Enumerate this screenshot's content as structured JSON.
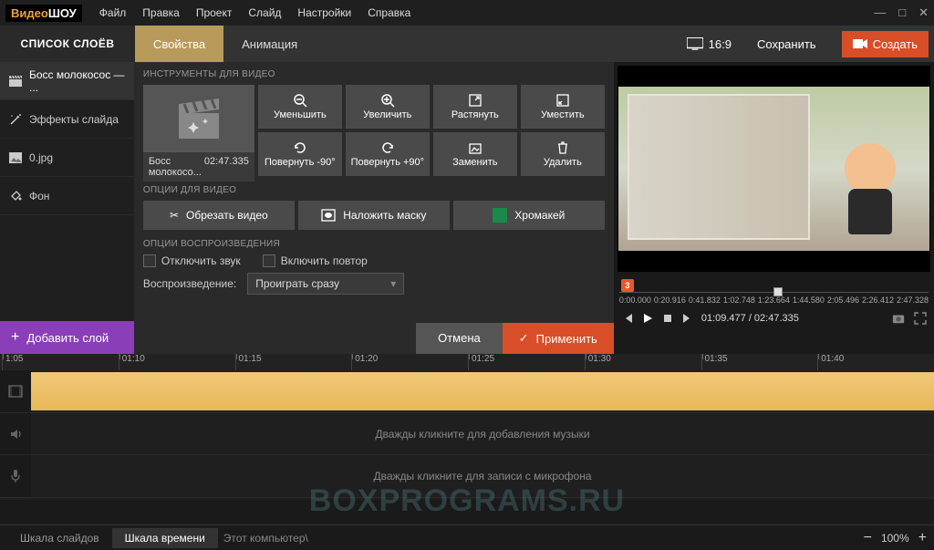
{
  "app": {
    "logo_a": "Видео",
    "logo_b": "ШОУ"
  },
  "menu": [
    "Файл",
    "Правка",
    "Проект",
    "Слайд",
    "Настройки",
    "Справка"
  ],
  "header": {
    "layers_title": "СПИСОК СЛОЁВ",
    "tab_props": "Свойства",
    "tab_anim": "Анимация",
    "aspect": "16:9",
    "save": "Сохранить",
    "create": "Создать"
  },
  "layers": [
    {
      "label": "Босс молокосос — ..."
    },
    {
      "label": "Эффекты слайда"
    },
    {
      "label": "0.jpg"
    },
    {
      "label": "Фон"
    }
  ],
  "add_layer": "Добавить слой",
  "props": {
    "section_tools": "ИНСТРУМЕНТЫ ДЛЯ ВИДЕО",
    "thumb_name": "Босс молокосо...",
    "thumb_time": "02:47.335",
    "zoom_out": "Уменьшить",
    "zoom_in": "Увеличить",
    "stretch": "Растянуть",
    "fit": "Уместить",
    "rot_ccw": "Повернуть -90°",
    "rot_cw": "Повернуть +90°",
    "replace": "Заменить",
    "delete": "Удалить",
    "section_opts": "ОПЦИИ ДЛЯ ВИДЕО",
    "crop": "Обрезать видео",
    "mask": "Наложить маску",
    "chroma": "Хромакей",
    "section_play": "ОПЦИИ ВОСПРОИЗВЕДЕНИЯ",
    "mute": "Отключить звук",
    "loop": "Включить повтор",
    "playback_label": "Воспроизведение:",
    "playback_value": "Проиграть сразу",
    "cancel": "Отмена",
    "apply": "Применить"
  },
  "preview": {
    "marker": "3",
    "ruler_labels": [
      "0:00.000",
      "0:20.916",
      "0:41.832",
      "1:02.748",
      "1:23.664",
      "1:44.580",
      "2:05.496",
      "2:26.412",
      "2:47.328"
    ],
    "time": "01:09.477 / 02:47.335"
  },
  "timeline": {
    "ticks": [
      "1:05",
      "01:10",
      "01:15",
      "01:20",
      "01:25",
      "01:30",
      "01:35",
      "01:40"
    ],
    "music_hint": "Дважды кликните для добавления музыки",
    "mic_hint": "Дважды кликните для записи с микрофона"
  },
  "bottom": {
    "tab_slides": "Шкала слайдов",
    "tab_time": "Шкала времени",
    "path": "Этот компьютер\\",
    "zoom": "100%"
  },
  "watermark": "BOXPROGRAMS.RU"
}
